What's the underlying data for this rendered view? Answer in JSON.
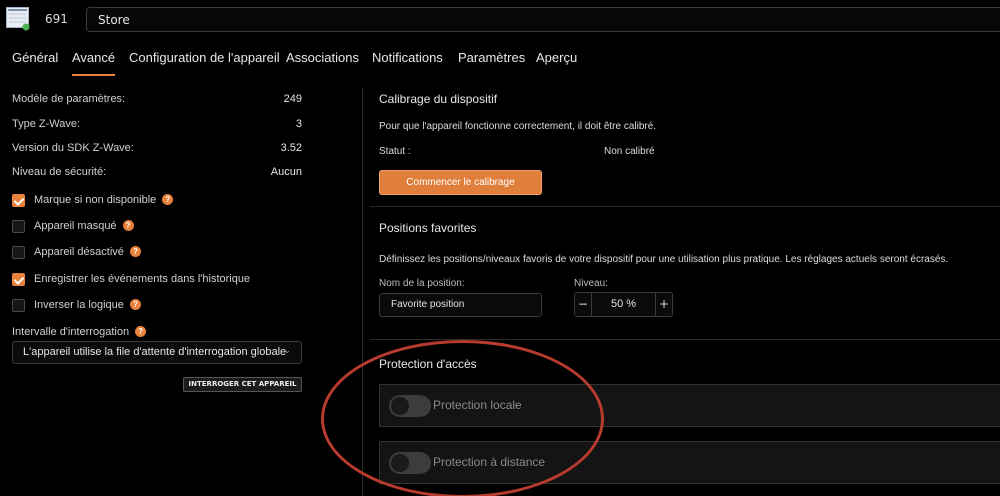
{
  "header": {
    "device_id": "691",
    "device_name": "Store",
    "device_icon": "window-blind-icon"
  },
  "tabs": [
    {
      "label": "Général",
      "active": false
    },
    {
      "label": "Avancé",
      "active": true
    },
    {
      "label": "Configuration de l'appareil",
      "active": false
    },
    {
      "label": "Associations",
      "active": false
    },
    {
      "label": "Notifications",
      "active": false
    },
    {
      "label": "Paramètres",
      "active": false
    },
    {
      "label": "Aperçu",
      "active": false
    }
  ],
  "info": [
    {
      "label": "Modèle de paramètres:",
      "value": "249"
    },
    {
      "label": "Type Z-Wave:",
      "value": "3"
    },
    {
      "label": "Version du SDK Z-Wave:",
      "value": "3.52"
    },
    {
      "label": "Niveau de sécurité:",
      "value": "Aucun"
    }
  ],
  "checkboxes": [
    {
      "label": "Marque si non disponible",
      "checked": true,
      "help": "?"
    },
    {
      "label": "Appareil masqué",
      "checked": false,
      "help": "?"
    },
    {
      "label": "Appareil désactivé",
      "checked": false,
      "help": "?"
    },
    {
      "label": "Enregistrer les événements dans l'historique",
      "checked": true
    },
    {
      "label": "Inverser la logique",
      "checked": false,
      "help": "?"
    }
  ],
  "polling": {
    "label": "Intervalle d'interrogation",
    "help": "?",
    "selected": "L'appareil utilise la file d'attente d'interrogation globale",
    "button": "INTERROGER CET APPAREIL"
  },
  "calibration": {
    "title": "Calibrage du dispositif",
    "description": "Pour que l'appareil fonctionne correctement, il doit être calibré.",
    "status_label": "Statut :",
    "status_value": "Non calibré",
    "button": "Commencer le calibrage"
  },
  "favorites": {
    "title": "Positions favorites",
    "description": "Définissez les positions/niveaux favoris de votre dispositif pour une utilisation plus pratique. Les réglages actuels seront écrasés.",
    "name_label": "Nom de la position:",
    "name_value": "Favorite position",
    "level_label": "Niveau:",
    "level_value": "50 %",
    "minus": "−",
    "plus": "+"
  },
  "access": {
    "title": "Protection d'accès",
    "toggles": [
      {
        "label": "Protection locale",
        "on": false
      },
      {
        "label": "Protection à distance",
        "on": false
      }
    ]
  },
  "colors": {
    "accent": "#e8823a",
    "annotation_circle": "#b83c2e",
    "background": "#000000"
  }
}
